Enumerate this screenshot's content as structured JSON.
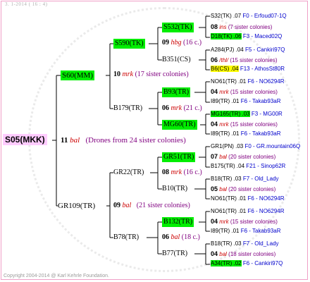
{
  "header": "3.  1-2014 ( 16 : 4)",
  "footer": "Copyright 2004-2014 @ Karl Kehrle Foundation.",
  "root": {
    "label": "S05(MKK)"
  },
  "g1": {
    "top": {
      "label": "S60(MM)"
    },
    "mid": {
      "num": "11",
      "mark": "bal",
      "desc": "(Drones from 24 sister colonies)"
    },
    "bot": {
      "label": "GR109(TR)"
    }
  },
  "g2": {
    "a": {
      "label": "S590(TK)"
    },
    "amid": {
      "num": "10",
      "mark": "mrk",
      "desc": "(17 sister colonies)"
    },
    "b": {
      "label": "B179(TR)"
    },
    "c": {
      "label": "GR22(TR)"
    },
    "cmid": {
      "num": "09",
      "mark": "bal",
      "desc": "(21 sister colonies)"
    },
    "d": {
      "label": "B78(TR)"
    }
  },
  "g3": {
    "a": {
      "label": "S532(TK)"
    },
    "amid": {
      "num": "09",
      "mark": "hbg",
      "desc": "(16 c.)"
    },
    "b": {
      "label": "B351(CS)"
    },
    "c": {
      "label": "B93(TR)"
    },
    "cmid": {
      "num": "06",
      "mark": "mrk",
      "desc": "(21 c.)"
    },
    "d": {
      "label": "MG60(TR)"
    },
    "e": {
      "label": "GR51(TR)"
    },
    "emid": {
      "num": "08",
      "mark": "mrk",
      "desc": "(16 c.)"
    },
    "f": {
      "label": "B10(TR)"
    },
    "g": {
      "label": "B132(TR)"
    },
    "gmid": {
      "num": "06",
      "mark": "bal",
      "desc": "(18 c.)"
    },
    "h": {
      "label": "B77(TR)"
    }
  },
  "g4": {
    "r1": {
      "label": "S32(TK)",
      "yr": ".07",
      "ref": "F0 - Erfoud07-1Q"
    },
    "r2": {
      "num": "08",
      "mark": "ins",
      "desc": "(7 sister colonies)"
    },
    "r3": {
      "label": "D18(TK)",
      "yr": ".06",
      "ref": "F3 - Maced02Q"
    },
    "r4": {
      "label": "A284(PJ)",
      "yr": ".04",
      "ref": "F5 - Cankiri97Q"
    },
    "r5": {
      "num": "06",
      "mark": "/thl/",
      "desc": "(15 sister colonies)"
    },
    "r6": {
      "label": "B6(CS)",
      "yr": ".04",
      "ref": "F13 - AthosSt80R"
    },
    "r7": {
      "label": "NO61(TR)",
      "yr": ".01",
      "ref": "F6 - NO6294R"
    },
    "r8": {
      "num": "04",
      "mark": "mrk",
      "desc": "(15 sister colonies)"
    },
    "r9": {
      "label": "I89(TR)",
      "yr": ".01",
      "ref": "F6 - Takab93aR"
    },
    "r10": {
      "label": "MG165(TR)",
      "yr": ".03",
      "ref": "F3 - MG00R"
    },
    "r11": {
      "num": "04",
      "mark": "mrk",
      "desc": "(15 sister colonies)"
    },
    "r12": {
      "label": "I89(TR)",
      "yr": ".01",
      "ref": "F6 - Takab93aR"
    },
    "r13": {
      "label": "GR1(PN)",
      "yr": ".03",
      "ref": "F0 - GR.mountain06Q"
    },
    "r14": {
      "num": "07",
      "mark": "bal",
      "desc": "(20 sister colonies)"
    },
    "r15": {
      "label": "B175(TR)",
      "yr": ".04",
      "ref": "F21 - Sinop62R"
    },
    "r16": {
      "label": "B18(TR)",
      "yr": ".03",
      "ref": "F7 - Old_Lady"
    },
    "r17": {
      "num": "05",
      "mark": "bal",
      "desc": "(20 sister colonies)"
    },
    "r18": {
      "label": "NO61(TR)",
      "yr": ".01",
      "ref": "F6 - NO6294R"
    },
    "r19": {
      "label": "NO61(TR)",
      "yr": ".01",
      "ref": "F6 - NO6294R"
    },
    "r20": {
      "num": "04",
      "mark": "mrk",
      "desc": "(15 sister colonies)"
    },
    "r21": {
      "label": "I89(TR)",
      "yr": ".01",
      "ref": "F6 - Takab93aR"
    },
    "r22": {
      "label": "B18(TR)",
      "yr": ".03",
      "ref": "F7 - Old_Lady"
    },
    "r23": {
      "num": "04",
      "mark": "bal",
      "desc": "(18 sister colonies)"
    },
    "r24": {
      "label": "A34(TR)",
      "yr": ".02",
      "ref": "F6 - Cankiri97Q"
    }
  }
}
